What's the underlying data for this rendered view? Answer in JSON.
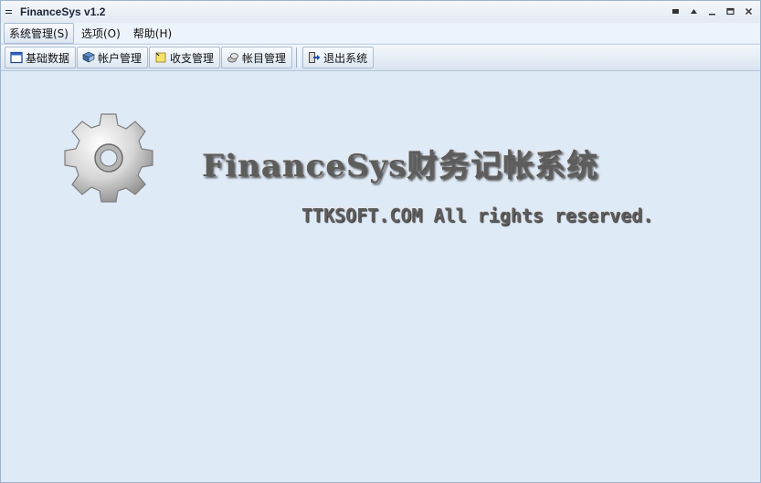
{
  "window": {
    "title": "FinanceSys v1.2",
    "controls": [
      "▪",
      "▴",
      "▁",
      "▫",
      "✕"
    ]
  },
  "menu": {
    "items": [
      {
        "label": "系统管理(S)"
      },
      {
        "label": "选项(O)"
      },
      {
        "label": "帮助(H)"
      }
    ]
  },
  "toolbar": {
    "buttons": [
      {
        "label": "基础数据",
        "icon": "window-icon"
      },
      {
        "label": "帐户管理",
        "icon": "book-icon"
      },
      {
        "label": "收支管理",
        "icon": "note-icon"
      },
      {
        "label": "帐目管理",
        "icon": "coins-icon"
      },
      {
        "label": "退出系统",
        "icon": "exit-icon"
      }
    ]
  },
  "main": {
    "headline": "FinanceSys财务记帐系统",
    "copyright": "TTKSOFT.COM All rights reserved."
  },
  "colors": {
    "background": "#dfeaf7",
    "text_relief": "#5d5d5d"
  }
}
